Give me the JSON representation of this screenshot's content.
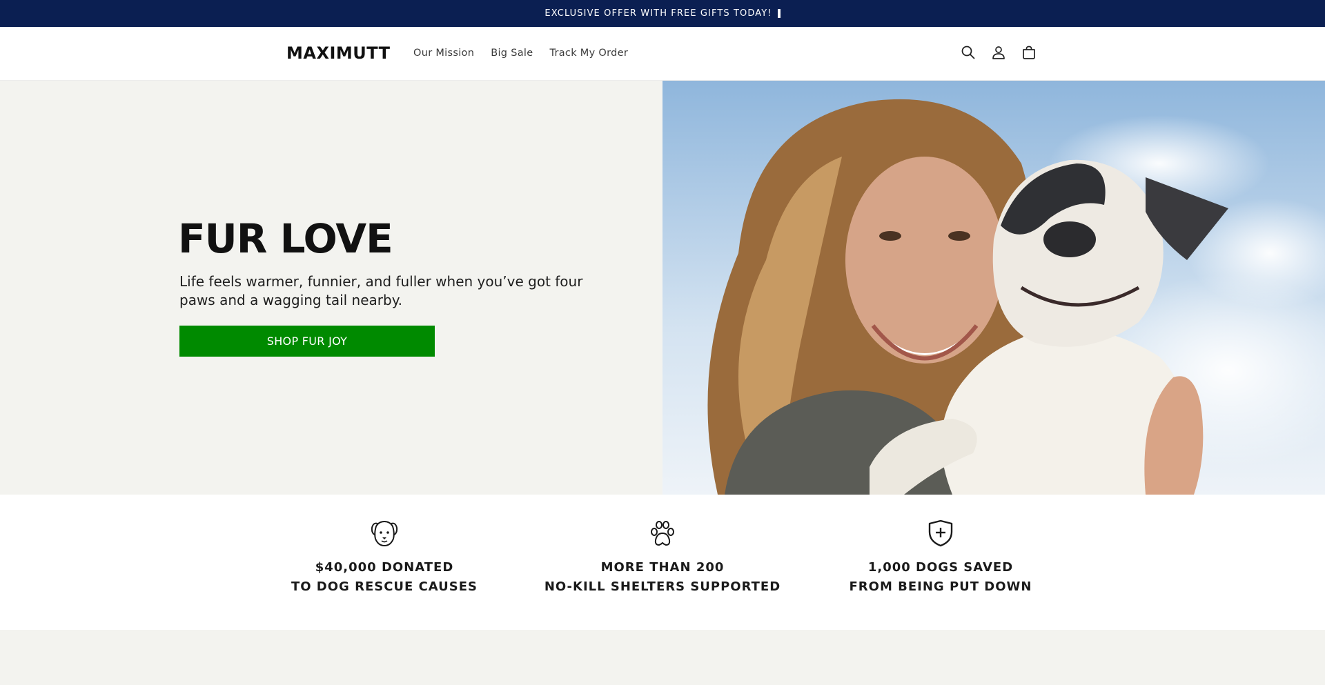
{
  "announcement": {
    "text": "EXCLUSIVE OFFER WITH FREE GIFTS TODAY!"
  },
  "header": {
    "logo": "MAXIMUTT",
    "nav": [
      {
        "label": "Our Mission"
      },
      {
        "label": "Big Sale"
      },
      {
        "label": "Track My Order"
      }
    ],
    "icons": [
      "search-icon",
      "account-icon",
      "cart-icon"
    ]
  },
  "hero": {
    "title": "FUR LOVE",
    "subtitle": "Life feels warmer, funnier, and fuller when you’ve got four paws and a wagging tail nearby.",
    "button_label": "SHOP FUR JOY",
    "button_color": "#008a00",
    "image_icon": "woman-hugging-dog-photo"
  },
  "stats": [
    {
      "icon": "dog-face-icon",
      "line1": "$40,000 DONATED",
      "line2": "TO DOG RESCUE CAUSES"
    },
    {
      "icon": "paw-icon",
      "line1": "MORE THAN 200",
      "line2": "NO-KILL SHELTERS SUPPORTED"
    },
    {
      "icon": "shield-plus-icon",
      "line1": "1,000 DOGS SAVED",
      "line2": "FROM BEING PUT DOWN"
    }
  ],
  "colors": {
    "announcement_bg": "#0b1f52",
    "page_bg": "#f3f3ef",
    "accent_green": "#008a00"
  }
}
